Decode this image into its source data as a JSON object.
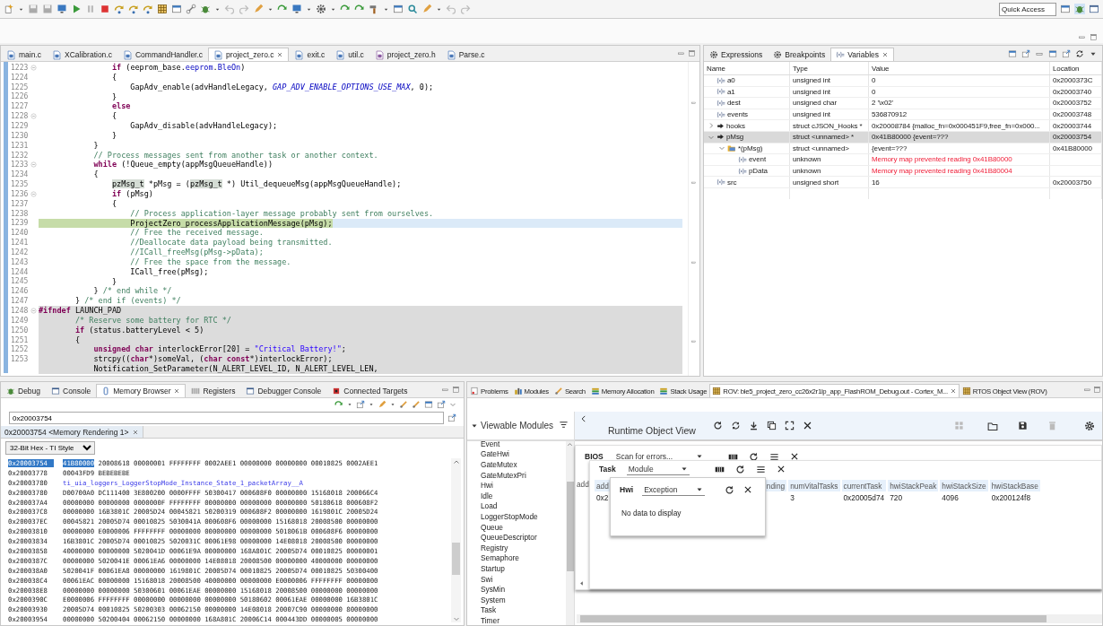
{
  "toolbar": {
    "quick_access": {
      "placeholder": "Quick Access"
    }
  },
  "editor": {
    "tabs": [
      {
        "label": "main.c",
        "kind": "source",
        "selected": false
      },
      {
        "label": "XCalibration.c",
        "kind": "source",
        "selected": false
      },
      {
        "label": "CommandHandler.c",
        "kind": "source",
        "selected": false
      },
      {
        "label": "project_zero.c",
        "kind": "source",
        "selected": true
      },
      {
        "label": "exit.c",
        "kind": "source",
        "selected": false
      },
      {
        "label": "util.c",
        "kind": "source",
        "selected": false
      },
      {
        "label": "project_zero.h",
        "kind": "header",
        "selected": false
      },
      {
        "label": "Parse.c",
        "kind": "source",
        "selected": false
      }
    ],
    "lines": [
      {
        "number": "1223",
        "fold": true,
        "current": false,
        "inactive": false,
        "segments": [
          {
            "kind": "keyword",
            "text": "                if"
          },
          {
            "kind": "plain",
            "text": " (eeprom_base."
          },
          {
            "kind": "field",
            "text": "eeprom"
          },
          {
            "kind": "plain",
            "text": "."
          },
          {
            "kind": "field",
            "text": "BleOn"
          },
          {
            "kind": "plain",
            "text": ")"
          }
        ]
      },
      {
        "number": "1224",
        "fold": false,
        "current": false,
        "inactive": false,
        "segments": [
          {
            "kind": "plain",
            "text": "                {"
          }
        ]
      },
      {
        "number": "1225",
        "fold": false,
        "current": false,
        "inactive": false,
        "segments": [
          {
            "kind": "plain",
            "text": "                    GapAdv_enable(advHandleLegacy, "
          },
          {
            "kind": "macro",
            "text": "GAP_ADV_ENABLE_OPTIONS_USE_MAX"
          },
          {
            "kind": "plain",
            "text": ", 0);"
          }
        ]
      },
      {
        "number": "1226",
        "fold": false,
        "current": false,
        "inactive": false,
        "segments": [
          {
            "kind": "plain",
            "text": "                }"
          }
        ]
      },
      {
        "number": "1227",
        "fold": false,
        "current": false,
        "inactive": false,
        "segments": [
          {
            "kind": "keyword",
            "text": "                else"
          }
        ]
      },
      {
        "number": "1228",
        "fold": true,
        "current": false,
        "inactive": false,
        "segments": [
          {
            "kind": "plain",
            "text": "                {"
          }
        ]
      },
      {
        "number": "1229",
        "fold": false,
        "current": false,
        "inactive": false,
        "segments": [
          {
            "kind": "plain",
            "text": "                    GapAdv_disable(advHandleLegacy);"
          }
        ]
      },
      {
        "number": "1230",
        "fold": false,
        "current": false,
        "inactive": false,
        "segments": [
          {
            "kind": "plain",
            "text": "                }"
          }
        ]
      },
      {
        "number": "1231",
        "fold": false,
        "current": false,
        "inactive": false,
        "segments": [
          {
            "kind": "plain",
            "text": "            }"
          }
        ]
      },
      {
        "number": "1232",
        "fold": false,
        "current": false,
        "inactive": false,
        "segments": [
          {
            "kind": "comment",
            "text": "            // Process messages sent from another task or another context."
          }
        ]
      },
      {
        "number": "1233",
        "fold": true,
        "current": false,
        "inactive": false,
        "segments": [
          {
            "kind": "keyword",
            "text": "            while"
          },
          {
            "kind": "plain",
            "text": " (!Queue_empty(appMsgQueueHandle))"
          }
        ]
      },
      {
        "number": "1234",
        "fold": false,
        "current": false,
        "inactive": false,
        "segments": [
          {
            "kind": "plain",
            "text": "            {"
          }
        ]
      },
      {
        "number": "1235",
        "fold": false,
        "current": false,
        "inactive": false,
        "segments": [
          {
            "kind": "occurrence",
            "text": "                pzMsg_t"
          },
          {
            "kind": "plain",
            "text": " *pMsg = ("
          },
          {
            "kind": "occurrence",
            "text": "pzMsg_t"
          },
          {
            "kind": "plain",
            "text": " *) Util_dequeueMsg(appMsgQueueHandle);"
          }
        ]
      },
      {
        "number": "1236",
        "fold": true,
        "current": false,
        "inactive": false,
        "segments": [
          {
            "kind": "keyword",
            "text": "                if"
          },
          {
            "kind": "plain",
            "text": " (pMsg)"
          }
        ]
      },
      {
        "number": "1237",
        "fold": false,
        "current": false,
        "inactive": false,
        "segments": [
          {
            "kind": "plain",
            "text": "                {"
          }
        ]
      },
      {
        "number": "1238",
        "fold": false,
        "current": false,
        "inactive": false,
        "segments": [
          {
            "kind": "comment",
            "text": "                    // Process application-layer message probably sent from ourselves."
          }
        ]
      },
      {
        "number": "1239",
        "fold": false,
        "current": true,
        "inactive": false,
        "segments": [
          {
            "kind": "plain",
            "text": "                    ProjectZero_processApplicationMessage(pMsg);"
          }
        ]
      },
      {
        "number": "1240",
        "fold": false,
        "current": false,
        "inactive": false,
        "segments": [
          {
            "kind": "comment",
            "text": "                    // Free the received message."
          }
        ]
      },
      {
        "number": "1241",
        "fold": false,
        "current": false,
        "inactive": false,
        "segments": [
          {
            "kind": "comment",
            "text": "                    //Deallocate data payload being transmitted."
          }
        ]
      },
      {
        "number": "1242",
        "fold": false,
        "current": false,
        "inactive": false,
        "segments": [
          {
            "kind": "comment",
            "text": "                    //ICall_freeMsg(pMsg->pData);"
          }
        ]
      },
      {
        "number": "1243",
        "fold": false,
        "current": false,
        "inactive": false,
        "segments": [
          {
            "kind": "comment",
            "text": "                    // Free the space from the message."
          }
        ]
      },
      {
        "number": "1244",
        "fold": false,
        "current": false,
        "inactive": false,
        "segments": [
          {
            "kind": "plain",
            "text": "                    ICall_free(pMsg);"
          }
        ]
      },
      {
        "number": "1245",
        "fold": false,
        "current": false,
        "inactive": false,
        "segments": [
          {
            "kind": "plain",
            "text": "                }"
          }
        ]
      },
      {
        "number": "1246",
        "fold": false,
        "current": false,
        "inactive": false,
        "segments": [
          {
            "kind": "plain",
            "text": "            } "
          },
          {
            "kind": "comment",
            "text": "/* end while */"
          }
        ]
      },
      {
        "number": "1247",
        "fold": false,
        "current": false,
        "inactive": false,
        "segments": [
          {
            "kind": "plain",
            "text": "        } "
          },
          {
            "kind": "comment",
            "text": "/* end if (events) */"
          }
        ]
      },
      {
        "number": "1248",
        "fold": true,
        "current": false,
        "inactive": true,
        "segments": [
          {
            "kind": "keyword",
            "text": "#ifndef"
          },
          {
            "kind": "plain",
            "text": " LAUNCH_PAD"
          }
        ]
      },
      {
        "number": "1249",
        "fold": false,
        "current": false,
        "inactive": true,
        "segments": [
          {
            "kind": "comment",
            "text": "        /* Reserve some battery for RTC */"
          }
        ]
      },
      {
        "number": "1250",
        "fold": false,
        "current": false,
        "inactive": true,
        "segments": [
          {
            "kind": "keyword",
            "text": "        if"
          },
          {
            "kind": "plain",
            "text": " (status.batteryLevel < 5)"
          }
        ]
      },
      {
        "number": "1251",
        "fold": false,
        "current": false,
        "inactive": true,
        "segments": [
          {
            "kind": "plain",
            "text": "        {"
          }
        ]
      },
      {
        "number": "1252",
        "fold": false,
        "current": false,
        "inactive": true,
        "segments": [
          {
            "kind": "keyword",
            "text": "            unsigned char"
          },
          {
            "kind": "plain",
            "text": " interlockError[20] = "
          },
          {
            "kind": "string",
            "text": "\"Critical Battery!\""
          },
          {
            "kind": "plain",
            "text": ";"
          }
        ]
      },
      {
        "number": "1253",
        "fold": false,
        "current": false,
        "inactive": true,
        "segments": [
          {
            "kind": "plain",
            "text": "            strcpy(("
          },
          {
            "kind": "keyword",
            "text": "char"
          },
          {
            "kind": "plain",
            "text": "*)someVal, ("
          },
          {
            "kind": "keyword",
            "text": "char const"
          },
          {
            "kind": "plain",
            "text": "*)interlockError);"
          }
        ]
      },
      {
        "fold": false,
        "current": false,
        "inactive": true,
        "segments": [
          {
            "kind": "plain",
            "text": "            Notification_SetParameter(N_ALERT_LEVEL_ID, N_ALERT_LEVEL_LEN,"
          }
        ]
      }
    ]
  },
  "variables_view": {
    "tabs": [
      {
        "label": "Expressions",
        "selected": false
      },
      {
        "label": "Breakpoints",
        "selected": false
      },
      {
        "label": "Variables",
        "selected": true
      }
    ],
    "columns": [
      "Name",
      "Type",
      "Value",
      "Location"
    ],
    "rows": [
      {
        "name": "a0",
        "kind": "variable",
        "type": "unsigned int",
        "value": "0",
        "location": "0x2000373C",
        "selected": false,
        "error": false
      },
      {
        "name": "a1",
        "kind": "variable",
        "type": "unsigned int",
        "value": "0",
        "location": "0x20003740",
        "selected": false,
        "error": false
      },
      {
        "name": "dest",
        "kind": "variable",
        "type": "unsigned char",
        "value": "2 '\\x02'",
        "location": "0x20003752",
        "selected": false,
        "error": false
      },
      {
        "name": "events",
        "kind": "variable",
        "type": "unsigned int",
        "value": "536870912",
        "location": "0x20003748",
        "selected": false,
        "error": false
      },
      {
        "name": "hooks",
        "kind": "pointer",
        "expanded": false,
        "type": "struct cJSON_Hooks *",
        "value": "0x20008784 {malloc_fn=0x000451F9,free_fn=0x000...",
        "location": "0x20003744",
        "selected": false,
        "error": false
      },
      {
        "name": "pMsg",
        "kind": "pointer",
        "expanded": true,
        "type": "struct <unnamed> *",
        "value": "0x41B80000 {event=???",
        "location": "0x20003754",
        "selected": true,
        "error": false,
        "children": [
          {
            "name": "*(pMsg)",
            "kind": "struct",
            "expanded": true,
            "type": "struct <unnamed>",
            "value": "{event=???",
            "location": "0x41B80000",
            "selected": false,
            "error": false,
            "children": [
              {
                "name": "event",
                "kind": "variable",
                "type": "unknown",
                "value": "Memory map prevented reading 0x41B80000",
                "selected": false,
                "error": true
              },
              {
                "name": "pData",
                "kind": "variable",
                "type": "unknown",
                "value": "Memory map prevented reading 0x41B80004",
                "selected": false,
                "error": true
              }
            ]
          }
        ]
      },
      {
        "name": "src",
        "kind": "variable",
        "type": "unsigned short",
        "value": "16",
        "location": "0x20003750",
        "selected": false,
        "error": false
      }
    ]
  },
  "memory_browser": {
    "tabs": [
      {
        "label": "Debug",
        "selected": false
      },
      {
        "label": "Console",
        "selected": false
      },
      {
        "label": "Memory Browser",
        "selected": true
      },
      {
        "label": "Registers",
        "selected": false
      },
      {
        "label": "Debugger Console",
        "selected": false
      },
      {
        "label": "Connected Targets",
        "selected": false
      }
    ],
    "address": "0x20003754",
    "rendering_tab": "0x20003754 <Memory Rendering 1>",
    "format": "32-Bit Hex - TI Style",
    "rows": [
      {
        "kind": "data",
        "address": "0x20003754",
        "selected": true,
        "values": "41B80000 20008618 00000001 FFFFFFFF 0002AEE1 00000000 00000000 00010825 0002AEE1"
      },
      {
        "kind": "data",
        "address": "0x20003778",
        "selected": false,
        "values": "00043FD9 BEBEBEBE"
      },
      {
        "kind": "symbol",
        "address": "0x20003780",
        "selected": false,
        "values": "ti_uia_loggers_LoggerStopMode_Instance_State_1_packetArray__A"
      },
      {
        "kind": "data",
        "address": "0x20003780",
        "selected": false,
        "values": "D00700A0 DC111400 3E800200 0000FFFF 50300417 000608F0 00000000 15168018 200066C4"
      },
      {
        "kind": "data",
        "address": "0x200037A4",
        "selected": false,
        "values": "00000000 00000000 0000000F FFFFFFFF 00000000 00000000 00000000 50180618 000608F2"
      },
      {
        "kind": "data",
        "address": "0x200037C8",
        "selected": false,
        "values": "00000000 16B3801C 20005D24 00045821 50200319 000608F2 00000000 1619801C 20005D24"
      },
      {
        "kind": "data",
        "address": "0x200037EC",
        "selected": false,
        "values": "00045821 20005D74 00010825 5030041A 000608F6 00000000 15168018 20008500 00000000"
      },
      {
        "kind": "data",
        "address": "0x20003810",
        "selected": false,
        "values": "00000000 E0000006 FFFFFFFF 00000000 00000000 00000000 5018061B 000608F6 00000000"
      },
      {
        "kind": "data",
        "address": "0x20003834",
        "selected": false,
        "values": "16B3801C 20005D74 00010825 5020031C 00061E98 00000000 14E08018 20008500 00000000"
      },
      {
        "kind": "data",
        "address": "0x20003858",
        "selected": false,
        "values": "40000000 00000000 5020041D 00061E9A 00000000 168A801C 20005D74 00010825 00000001"
      },
      {
        "kind": "data",
        "address": "0x2000387C",
        "selected": false,
        "values": "00000000 5020041E 00061EA6 00000000 14E08018 20008500 00000000 40000000 00000000"
      },
      {
        "kind": "data",
        "address": "0x200038A0",
        "selected": false,
        "values": "5020041F 00061EA8 00000000 1619801C 20005D74 00010825 20005D74 00010825 50300400"
      },
      {
        "kind": "data",
        "address": "0x200038C4",
        "selected": false,
        "values": "00061EAC 00000000 15168018 20008500 40000000 00000000 E0000006 FFFFFFFF 00000000"
      },
      {
        "kind": "data",
        "address": "0x200038E8",
        "selected": false,
        "values": "00000000 00000000 50300601 00061EAE 00000000 15168018 20008500 00000000 00000000"
      },
      {
        "kind": "data",
        "address": "0x2000390C",
        "selected": false,
        "values": "E0000006 FFFFFFFF 00000000 00000000 00000000 50180602 00061EAE 00000000 16B3801C"
      },
      {
        "kind": "data",
        "address": "0x20003930",
        "selected": false,
        "values": "20005D74 00010825 50200303 00062150 00000000 14E08018 20007C90 00000000 80000000"
      },
      {
        "kind": "data",
        "address": "0x20003954",
        "selected": false,
        "values": "00000000 50200404 00062150 00000000 168A801C 20006C14 000443DD 00000005 00000000"
      }
    ]
  },
  "rov": {
    "tabs": [
      {
        "label": "Problems",
        "selected": false
      },
      {
        "label": "Modules",
        "selected": false
      },
      {
        "label": "Search",
        "selected": false
      },
      {
        "label": "Memory Allocation",
        "selected": false
      },
      {
        "label": "Stack Usage",
        "selected": false
      },
      {
        "label": "ROV: ble5_project_zero_cc26x2r1lp_app_FlashROM_Debug.out - Cortex_M...",
        "selected": true
      },
      {
        "label": "RTOS Object View (ROV)",
        "selected": false
      }
    ],
    "modules_title": "Viewable Modules",
    "modules": [
      "Event",
      "GateHwi",
      "GateMutex",
      "GateMutexPri",
      "Hwi",
      "Idle",
      "Load",
      "LoggerStopMode",
      "Queue",
      "QueueDescriptor",
      "Registry",
      "Semaphore",
      "Startup",
      "Swi",
      "SysMin",
      "System",
      "Task",
      "Timer"
    ],
    "title": "Runtime Object View",
    "bios": {
      "label": "BIOS",
      "dropdown": "Scan for errors...",
      "column_1": "add"
    },
    "task": {
      "label": "Task",
      "dropdown": "Module",
      "columns": [
        {
          "header": "add",
          "value": "0x2"
        },
        {
          "header": "nding"
        },
        {
          "header": "numVitalTasks",
          "value": "3"
        },
        {
          "header": "currentTask",
          "value": "0x20005d74"
        },
        {
          "header": "hwiStackPeak",
          "value": "720"
        },
        {
          "header": "hwiStackSize",
          "value": "4096"
        },
        {
          "header": "hwiStackBase",
          "value": "0x200124f8"
        }
      ]
    },
    "hwi": {
      "label": "Hwi",
      "dropdown": "Exception",
      "message": "No data to display"
    }
  }
}
